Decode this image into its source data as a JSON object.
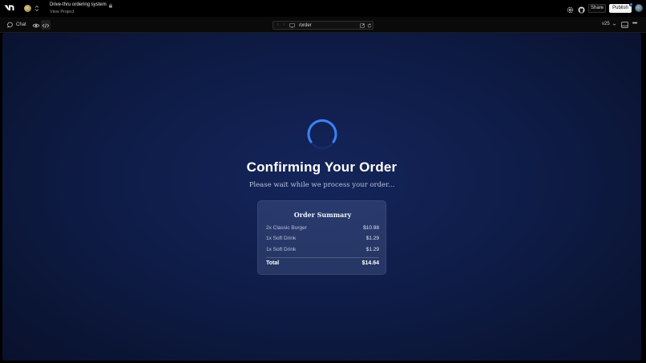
{
  "header": {
    "project_title": "Drive-thru ordering system",
    "view_project": "View Project",
    "share_label": "Share",
    "publish_label": "Publish"
  },
  "toolbar": {
    "chat_label": "Chat",
    "url": "/order",
    "version": "v25"
  },
  "preview": {
    "title": "Confirming Your Order",
    "subtitle": "Please wait while we process your order...",
    "summary": {
      "title": "Order Summary",
      "items": [
        {
          "label": "2x Classic Burger",
          "price": "$10.98"
        },
        {
          "label": "1x Soft Drink",
          "price": "$1.29"
        },
        {
          "label": "1x Soft Drink",
          "price": "$1.29"
        }
      ],
      "total_label": "Total",
      "total_value": "$14.64"
    }
  },
  "colors": {
    "accent": "#3b82f6",
    "background": "#0f1d4a"
  }
}
